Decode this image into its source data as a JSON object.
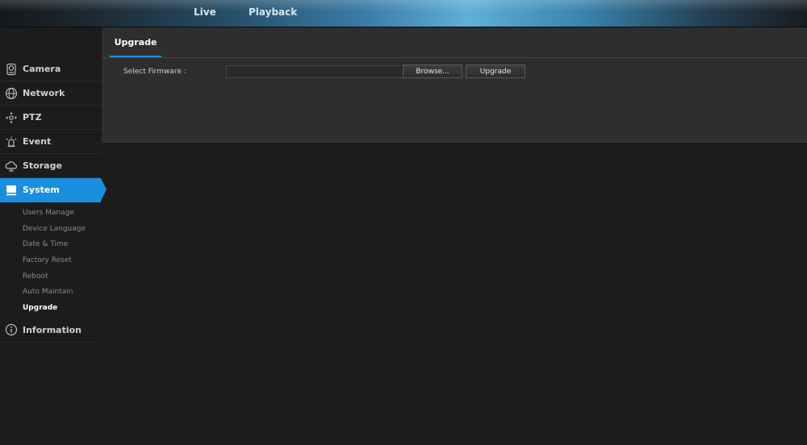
{
  "topnav": {
    "live": "Live",
    "playback": "Playback"
  },
  "sidebar": {
    "items": [
      {
        "label": "Camera",
        "icon": "camera-icon"
      },
      {
        "label": "Network",
        "icon": "globe-icon"
      },
      {
        "label": "PTZ",
        "icon": "ptz-icon"
      },
      {
        "label": "Event",
        "icon": "alarm-icon"
      },
      {
        "label": "Storage",
        "icon": "cloud-storage-icon"
      },
      {
        "label": "System",
        "icon": "monitor-icon",
        "active": true
      },
      {
        "label": "Information",
        "icon": "info-icon"
      }
    ],
    "system_sub": [
      "Users Manage",
      "Device Language",
      "Date & Time",
      "Factory Reset",
      "Reboot",
      "Auto Maintain",
      "Upgrade"
    ]
  },
  "panel": {
    "tab": "Upgrade",
    "select_firmware_label": "Select Firmware :",
    "firmware_value": "",
    "browse_label": "Browse...",
    "upgrade_label": "Upgrade"
  },
  "colors": {
    "accent": "#1a8fe0",
    "background": "#1c1c1c",
    "panel": "#2e2e2e"
  }
}
